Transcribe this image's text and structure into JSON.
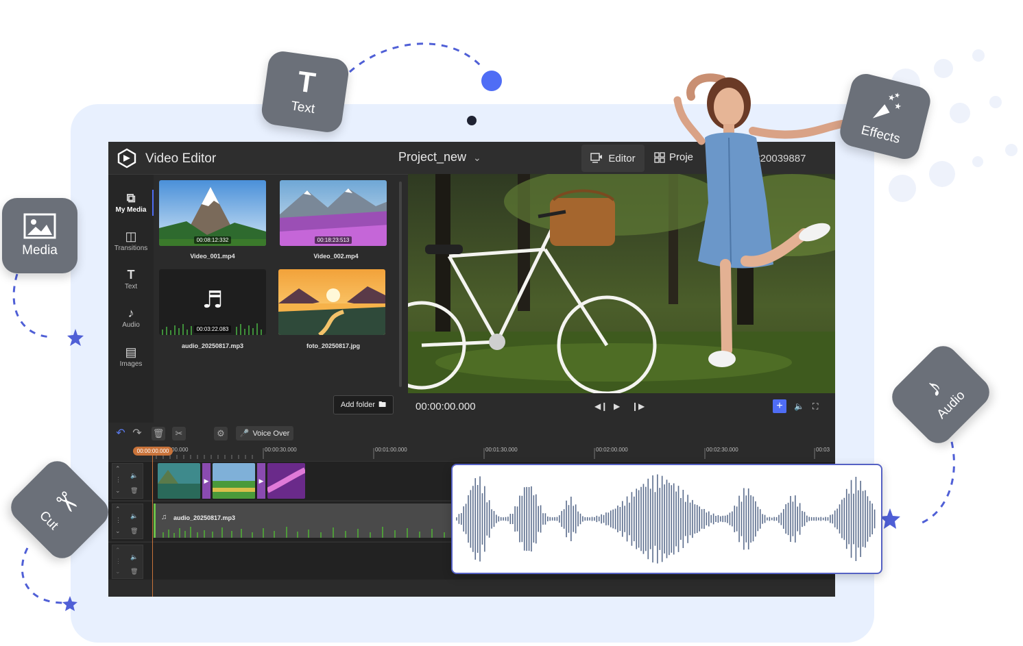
{
  "app": {
    "title": "Video Editor",
    "project_name": "Project_new",
    "tabs": [
      {
        "label": "Editor",
        "icon": "editor-icon"
      },
      {
        "label": "Proje",
        "icon": "grid-icon"
      }
    ],
    "user_phone": "1820039887"
  },
  "feature_badges": {
    "text": "Text",
    "media": "Media",
    "effects": "Effects",
    "audio": "Audio",
    "cut": "Cut"
  },
  "sidebar": {
    "items": [
      {
        "label": "My Media",
        "icon": "layers-icon"
      },
      {
        "label": "Transitions",
        "icon": "transitions-icon"
      },
      {
        "label": "Text",
        "icon": "text-icon"
      },
      {
        "label": "Audio",
        "icon": "music-note-icon"
      },
      {
        "label": "Images",
        "icon": "image-icon"
      }
    ]
  },
  "media": {
    "items": [
      {
        "name": "Video_001.mp4",
        "duration": "00:08:12:332",
        "type": "video"
      },
      {
        "name": "Video_002.mp4",
        "duration": "00:18:23:513",
        "type": "video"
      },
      {
        "name": "audio_20250817.mp3",
        "duration": "00:03:22.083",
        "type": "audio"
      },
      {
        "name": "foto_20250817.jpg",
        "duration": "",
        "type": "image"
      }
    ],
    "add_folder_label": "Add folder"
  },
  "player": {
    "timecode": "00:00:00.000"
  },
  "toolbar": {
    "voice_over_label": "Voice Over"
  },
  "timeline": {
    "playhead": "00:00:00.000",
    "ticks": [
      "00.000",
      "00:00:30.000",
      "00:01:00.000",
      "00:01:30.000",
      "00:02:00.000",
      "00:02:30.000",
      "00:03"
    ],
    "audio_clip_name": "audio_20250817.mp3"
  },
  "colors": {
    "accent": "#4f6df5",
    "badge": "#6b7079",
    "panel_bg": "#e8f0fe",
    "transition": "#8a4bb0",
    "playhead": "#c9733a",
    "waveform": "#5a6c8c"
  }
}
